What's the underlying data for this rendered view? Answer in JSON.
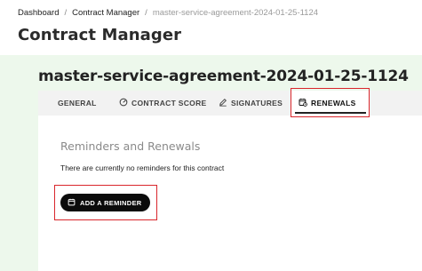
{
  "breadcrumb": {
    "items": [
      "Dashboard",
      "Contract Manager",
      "master-service-agreement-2024-01-25-1124"
    ],
    "separator": "/"
  },
  "page_title": "Contract Manager",
  "contract": {
    "name": "master-service-agreement-2024-01-25-1124"
  },
  "tabs": [
    {
      "label": "GENERAL",
      "icon": "none",
      "active": false
    },
    {
      "label": "CONTRACT SCORE",
      "icon": "gauge-icon",
      "active": false
    },
    {
      "label": "SIGNATURES",
      "icon": "pen-icon",
      "active": false
    },
    {
      "label": "RENEWALS",
      "icon": "calendar-clock-icon",
      "active": true
    }
  ],
  "renewals": {
    "section_title": "Reminders and Renewals",
    "empty_message": "There are currently no reminders for this contract",
    "add_button_label": "ADD A REMINDER"
  },
  "colors": {
    "panel_background": "#edf8ec",
    "highlight_border": "#d9262c",
    "button_background": "#0b0b0b"
  }
}
